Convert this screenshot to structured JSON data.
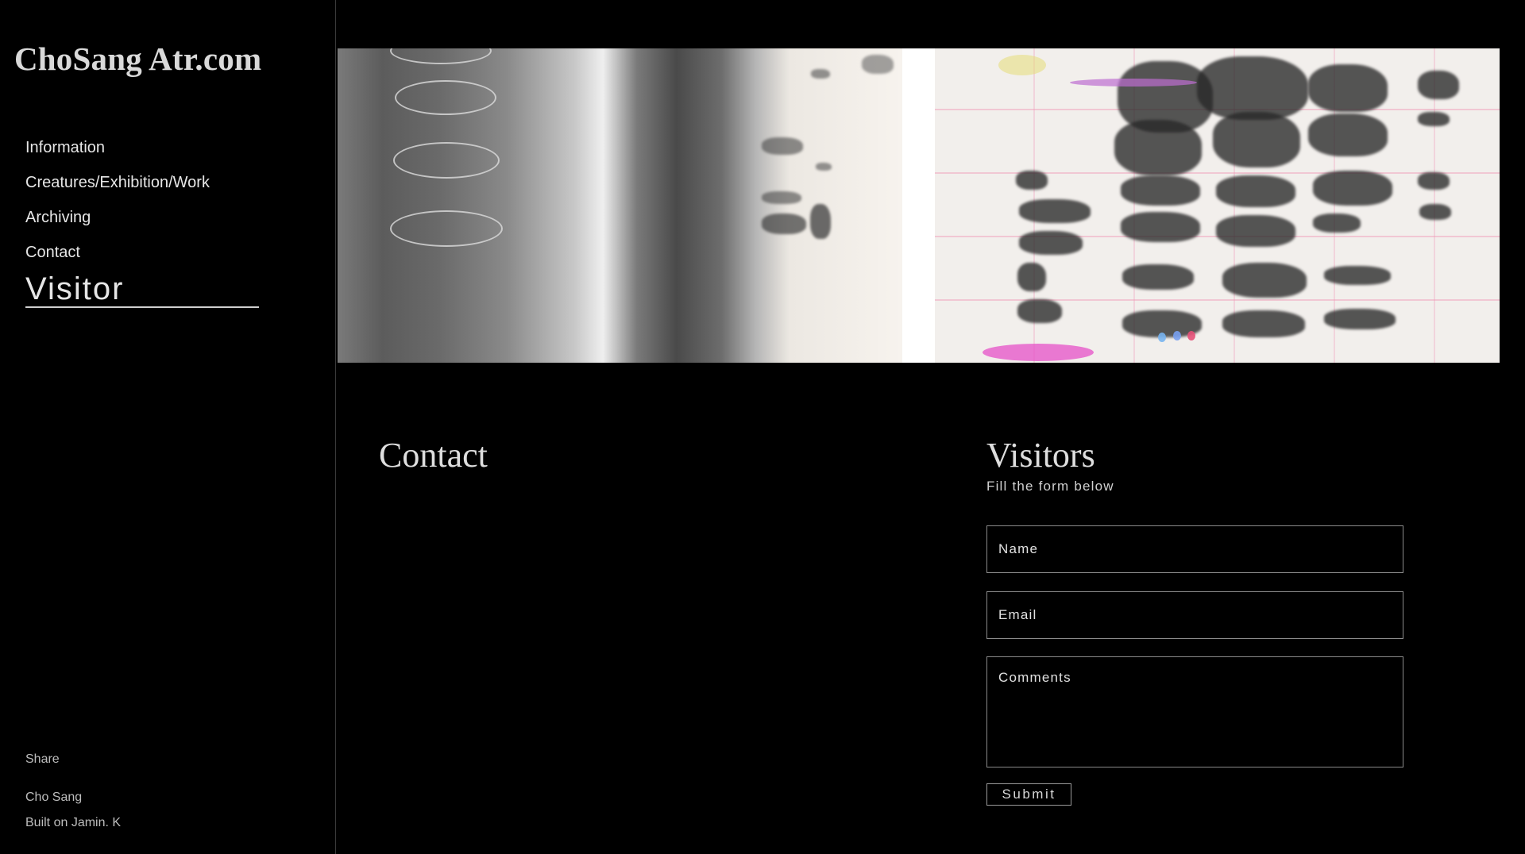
{
  "site": {
    "title": "ChoSang Atr.com"
  },
  "nav": {
    "items": [
      {
        "label": "Information"
      },
      {
        "label": "Creatures/Exhibition/Work"
      },
      {
        "label": "Archiving"
      },
      {
        "label": "Contact"
      },
      {
        "label": "Visitor",
        "active": true
      }
    ]
  },
  "sidebar_footer": {
    "share": "Share",
    "author": "Cho Sang",
    "credit": "Built on Jamin. K"
  },
  "contact": {
    "heading": "Contact"
  },
  "visitors": {
    "heading": "Visitors",
    "subheading": "Fill the form below",
    "name_placeholder": "Name",
    "email_placeholder": "Email",
    "comments_placeholder": "Comments",
    "submit_label": "Submit"
  },
  "colors": {
    "background": "#000000",
    "text": "#e6e6e6",
    "border": "#8a8a8a"
  },
  "icons": []
}
